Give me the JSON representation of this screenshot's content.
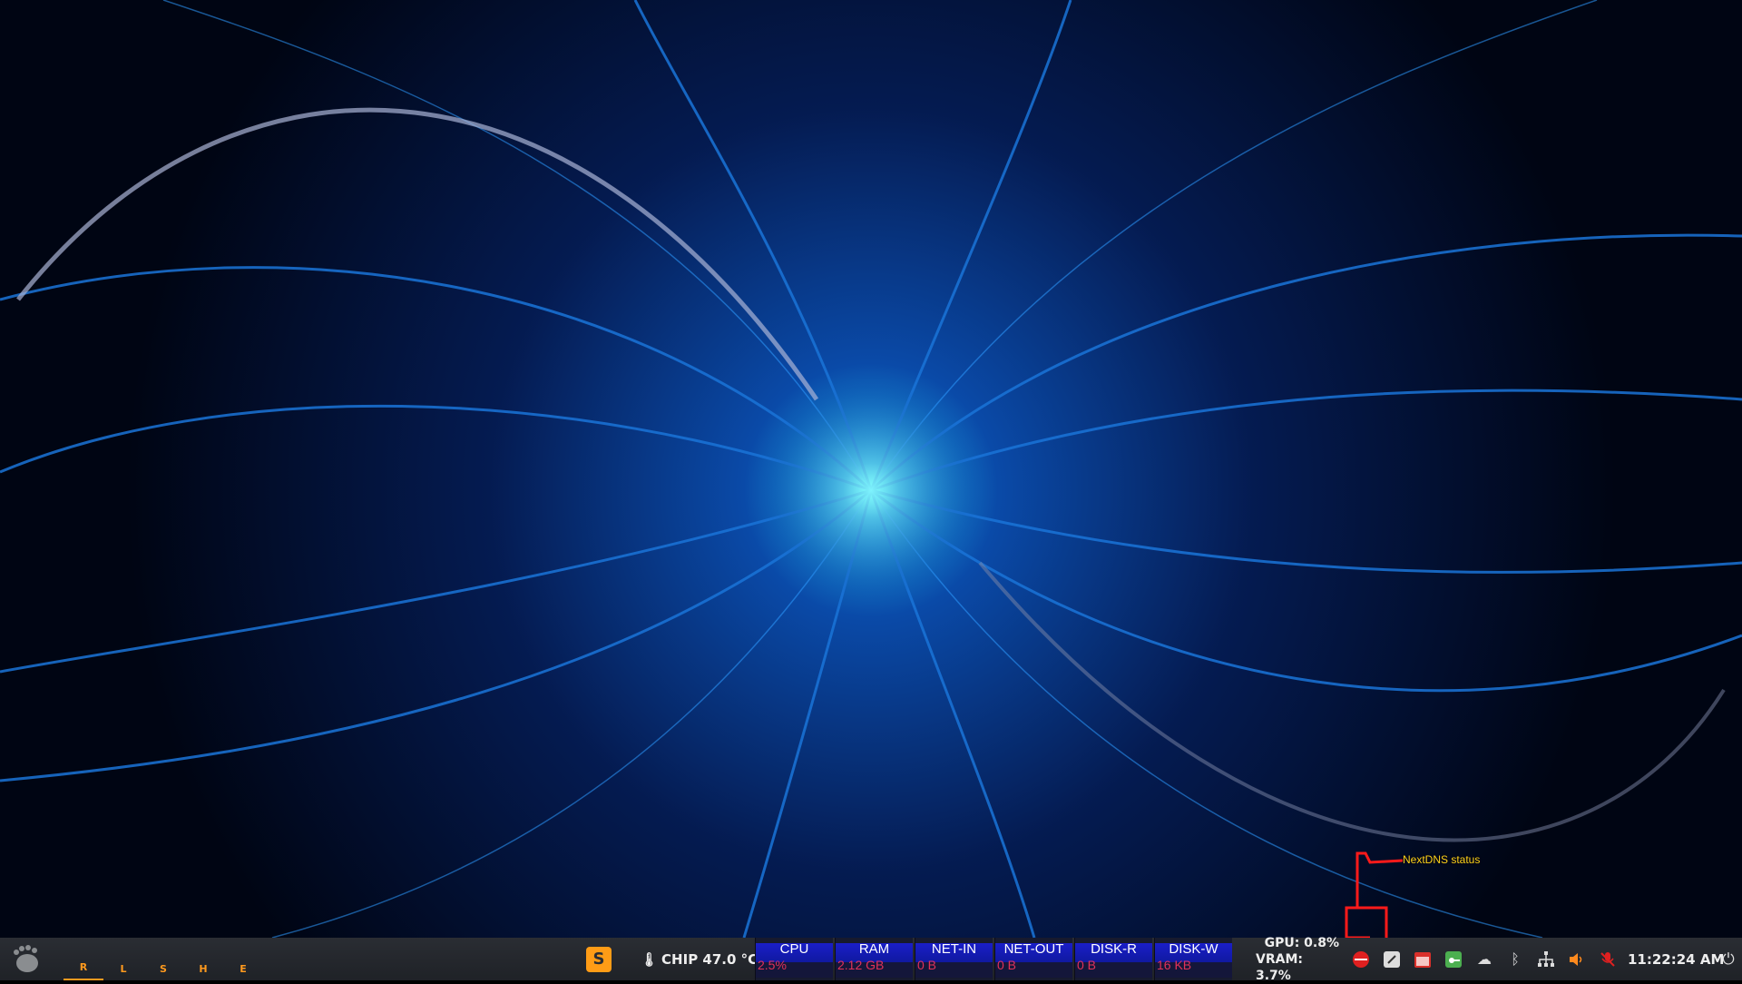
{
  "annotation": {
    "label": "NextDNS status",
    "color": "#ff1a1a",
    "label_color": "#ffd21a"
  },
  "taskbar": {
    "workspaces": [
      {
        "label": "R",
        "active": true
      },
      {
        "label": "L",
        "active": false
      },
      {
        "label": "S",
        "active": false
      },
      {
        "label": "H",
        "active": false
      },
      {
        "label": "E",
        "active": false
      }
    ],
    "app_letter": "S",
    "chip_label": "CHIP 47.0 °C",
    "meters": [
      {
        "label": "CPU",
        "value": "2.5%"
      },
      {
        "label": "RAM",
        "value": "2.12 GB"
      },
      {
        "label": "NET-IN",
        "value": "0 B"
      },
      {
        "label": "NET-OUT",
        "value": "0 B"
      },
      {
        "label": "DISK-R",
        "value": "0 B"
      },
      {
        "label": "DISK-W",
        "value": "16 KB"
      }
    ],
    "gpu": "GPU: 0.8%",
    "vram": "VRAM: 3.7%",
    "clock": "11:22:24 AM"
  },
  "colors": {
    "accent_orange": "#ff9a1e",
    "meter_value": "#e0325a",
    "taskbar_bg": "#24272c"
  }
}
